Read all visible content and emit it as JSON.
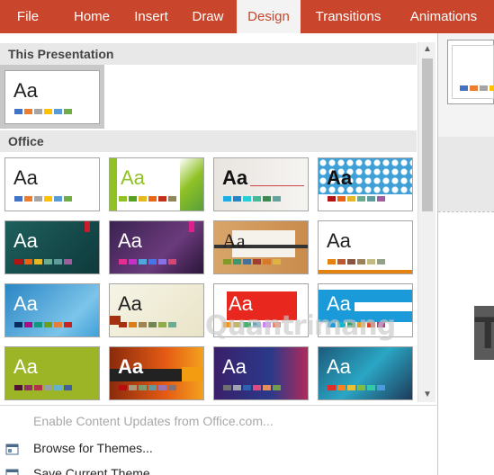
{
  "ribbon": {
    "tabs": [
      {
        "label": "File"
      },
      {
        "label": "Home"
      },
      {
        "label": "Insert"
      },
      {
        "label": "Draw"
      },
      {
        "label": "Design",
        "active": true
      },
      {
        "label": "Transitions"
      },
      {
        "label": "Animations"
      }
    ],
    "color": "#c9462c"
  },
  "gallery": {
    "section_this": "This Presentation",
    "section_office": "Office",
    "aa_text": "Aa"
  },
  "menu": {
    "enable_updates": "Enable Content Updates from Office.com...",
    "browse_themes": "Browse for Themes...",
    "save_theme": "Save Current Theme..."
  },
  "watermark": "Quantrimang",
  "slide_text": "T"
}
